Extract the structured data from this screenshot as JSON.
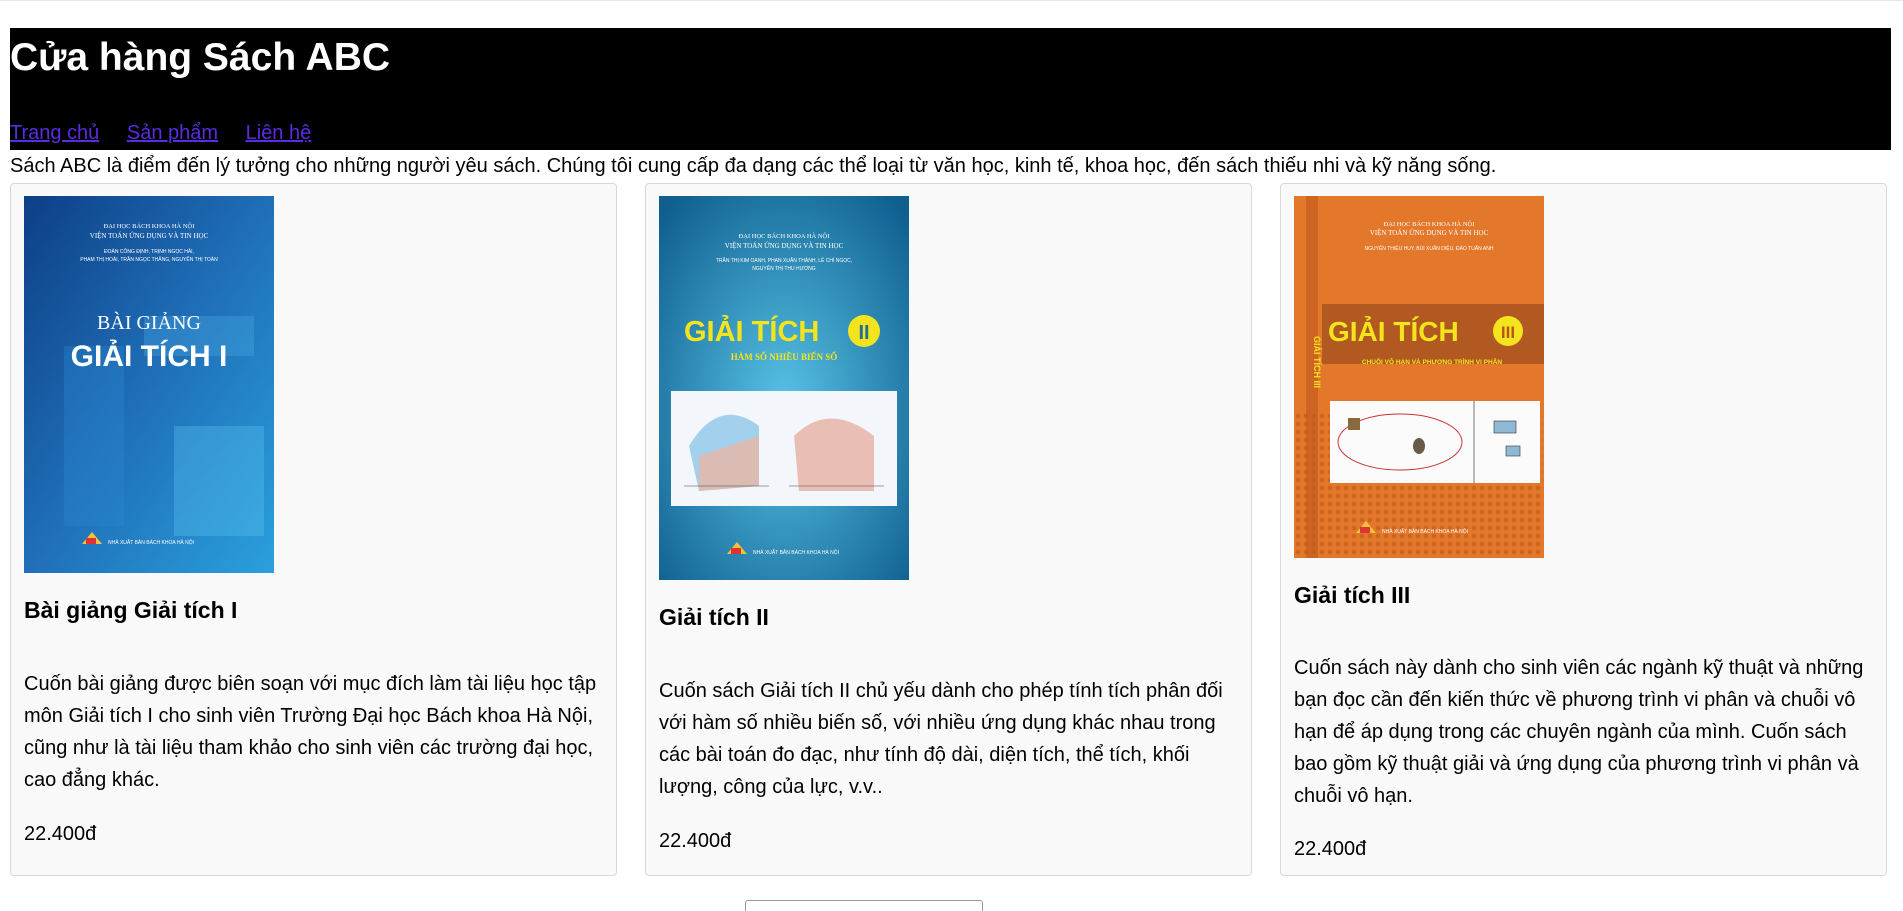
{
  "site": {
    "title": "Cửa hàng Sách ABC",
    "nav": [
      "Trang chủ",
      "Sản phẩm",
      "Liên hệ"
    ],
    "intro": "Sách ABC là điểm đến lý tưởng cho những người yêu sách. Chúng tôi cung cấp đa dạng các thể loại từ văn học, kinh tế, khoa học, đến sách thiếu nhi và kỹ năng sống."
  },
  "products": [
    {
      "title": "Bài giảng Giải tích I",
      "description": "Cuốn bài giảng được biên soạn với mục đích làm tài liệu học tập môn Giải tích I cho sinh viên Trường Đại học Bách khoa Hà Nội, cũng như là tài liệu tham khảo cho sinh viên các trường đại học, cao đẳng khác.",
      "price": "22.400đ",
      "cover": {
        "university": "ĐẠI HỌC BÁCH KHOA HÀ NỘI",
        "institute": "VIỆN TOÁN ỨNG DỤNG VÀ TIN HỌC",
        "authors": [
          "ĐOÀN CÔNG ĐỊNH, TRỊNH NGỌC HẢI,",
          "PHẠM THỊ HOÀI, TRẦN NGỌC THĂNG, NGUYỄN THỊ TOÀN"
        ],
        "kicker": "BÀI GIẢNG",
        "big_title": "GIẢI TÍCH I",
        "publisher": "NHÀ XUẤT BẢN BÁCH KHOA HÀ NỘI",
        "color": "#1f6fb8"
      }
    },
    {
      "title": "Giải tích II",
      "description": "Cuốn sách Giải tích II chủ yếu dành cho phép tính tích phân đối với hàm số nhiều biến số, với nhiều ứng dụng khác nhau trong các bài toán đo đạc, như tính độ dài, diện tích, thể tích, khối lượng, công của lực, v.v..",
      "price": "22.400đ",
      "cover": {
        "university": "ĐẠI HỌC BÁCH KHOA HÀ NỘI",
        "institute": "VIỆN TOÁN ỨNG DỤNG VÀ TIN HỌC",
        "authors": [
          "TRẦN THỊ KIM OANH, PHAN XUÂN THÀNH, LÊ CHÍ NGỌC,",
          "NGUYỄN THỊ THU HƯƠNG"
        ],
        "big_title": "GIẢI TÍCH",
        "numeral": "II",
        "subtitle": "HÀM SỐ NHIỀU BIẾN SỐ",
        "publisher": "NHÀ XUẤT BẢN BÁCH KHOA HÀ NỘI",
        "color": "#1c82ab"
      }
    },
    {
      "title": "Giải tích III",
      "description": "Cuốn sách này dành cho sinh viên các ngành kỹ thuật và những bạn đọc cần đến kiến thức về phương trình vi phân và chuỗi vô hạn để áp dụng trong các chuyên ngành của mình. Cuốn sách bao gồm kỹ thuật giải và ứng dụng của phương trình vi phân và chuỗi vô hạn.",
      "price": "22.400đ",
      "cover": {
        "university": "ĐẠI HỌC BÁCH KHOA HÀ NỘI",
        "institute": "VIỆN TOÁN ỨNG DỤNG VÀ TIN HỌC",
        "authors": [
          "NGUYỄN THIỆU HUY, BÙI XUÂN DIỆU, ĐÀO TUẤN ANH"
        ],
        "big_title": "GIẢI TÍCH",
        "numeral": "III",
        "subtitle": "CHUỖI VÔ HẠN VÀ PHƯƠNG TRÌNH VI PHÂN",
        "spine": "GIẢI TÍCH III",
        "publisher": "NHÀ XUẤT BẢN BÁCH KHOA HÀ NỘI",
        "color": "#e3772a"
      }
    }
  ]
}
